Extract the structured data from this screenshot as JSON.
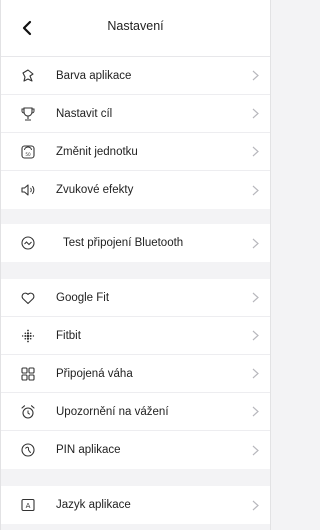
{
  "header": {
    "title": "Nastavení",
    "back_icon": "chevron-left-icon"
  },
  "group1": {
    "items": [
      {
        "label": "Barva aplikace",
        "icon": "paint-icon"
      },
      {
        "label": "Nastavit cíl",
        "icon": "trophy-icon"
      },
      {
        "label": "Změnit jednotku",
        "icon": "scale-unit-icon"
      },
      {
        "label": "Zvukové efekty",
        "icon": "speaker-icon"
      }
    ]
  },
  "group2": {
    "items": [
      {
        "label": "Test připojení Bluetooth",
        "icon": "bluetooth-test-icon"
      }
    ]
  },
  "group3": {
    "items": [
      {
        "label": "Google Fit",
        "icon": "heart-icon"
      },
      {
        "label": "Fitbit",
        "icon": "fitbit-icon"
      },
      {
        "label": "Připojená váha",
        "icon": "grid-icon"
      },
      {
        "label": "Upozornění na vážení",
        "icon": "alarm-clock-icon"
      },
      {
        "label": "PIN aplikace",
        "icon": "pin-lock-icon"
      }
    ]
  },
  "group4": {
    "items": [
      {
        "label": "Jazyk aplikace",
        "icon": "language-icon"
      }
    ]
  },
  "colors": {
    "background": "#f3f3f5",
    "card": "#ffffff",
    "divider": "#ededf0",
    "chevron": "#b8b8bd",
    "icon": "#333333"
  }
}
